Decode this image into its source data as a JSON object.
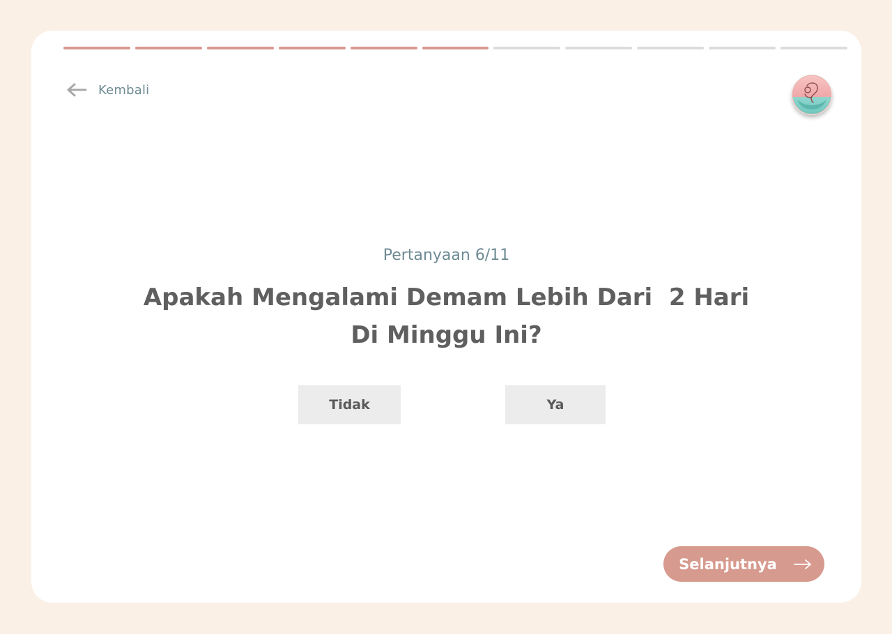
{
  "progress": {
    "total": 11,
    "completed": 6,
    "active_color": "#d79a8e",
    "inactive_color": "#dcdcdc"
  },
  "nav": {
    "back_label": "Kembali",
    "back_icon": "arrow-left-icon",
    "logo_icon": "mother-baby-logo"
  },
  "question": {
    "counter": "Pertanyaan 6/11",
    "text": "Apakah Mengalami Demam Lebih Dari  2 Hari Di Minggu Ini?"
  },
  "options": [
    {
      "label": "Tidak"
    },
    {
      "label": "Ya"
    }
  ],
  "footer": {
    "next_label": "Selanjutnya",
    "next_icon": "arrow-right-icon"
  },
  "colors": {
    "page_bg": "#fbf0e6",
    "card_bg": "#ffffff",
    "accent": "#d79a8e",
    "muted_text": "#6e8b93",
    "heading_text": "#5f5f5f",
    "option_bg": "#ececec"
  }
}
